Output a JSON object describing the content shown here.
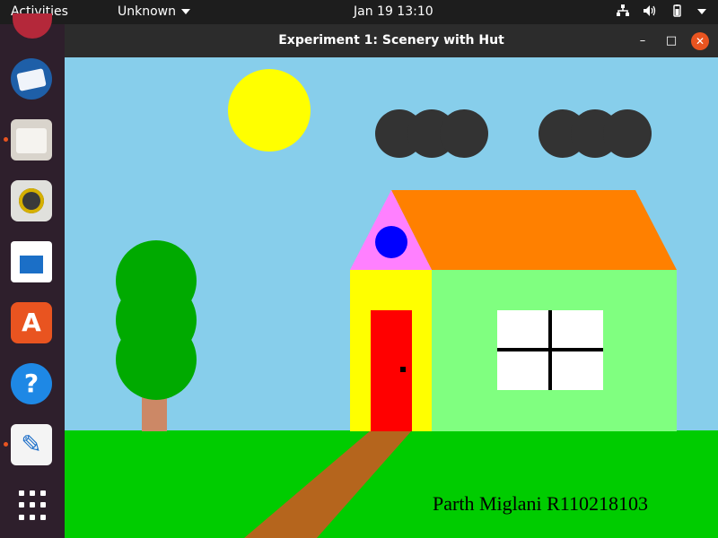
{
  "topbar": {
    "activities": "Activities",
    "app_menu": "Unknown",
    "clock": "Jan 19  13:10"
  },
  "window": {
    "title": "Experiment 1: Scenery with Hut"
  },
  "scene": {
    "signature": "Parth Miglani R110218103",
    "colors": {
      "sky": "#87ceeb",
      "grass": "#00cc00",
      "sun": "#ffff00",
      "clouds": "#333333",
      "roof": "#ff8000",
      "gable": "#ff80ff",
      "gable_window": "#0000ff",
      "front_wall": "#ffff00",
      "side_wall": "#80ff80",
      "door": "#ff0000",
      "window": "#ffffff",
      "tree_leaves": "#00aa00",
      "tree_trunk": "#cc8866",
      "path": "#b5651d"
    }
  },
  "dock": {
    "icons": [
      "app-icon",
      "thunderbird-icon",
      "files-icon",
      "rhythmbox-icon",
      "writer-icon",
      "software-icon",
      "help-icon",
      "text-editor-icon",
      "show-apps-icon"
    ]
  }
}
